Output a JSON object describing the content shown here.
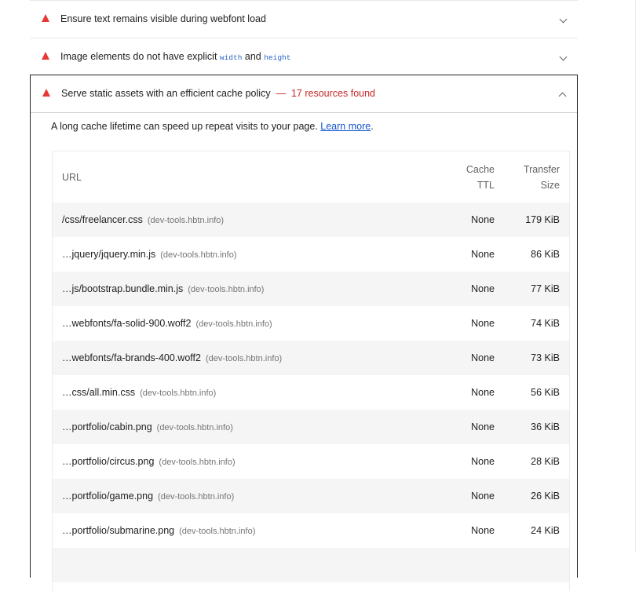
{
  "audits": [
    {
      "title": "Ensure text remains visible during webfont load",
      "status_icon": "fail-triangle-icon",
      "expanded": false
    },
    {
      "title_prefix": "Image elements do not have explicit ",
      "code_a": "width",
      "title_mid": " and ",
      "code_b": "height",
      "status_icon": "fail-triangle-icon",
      "expanded": false
    }
  ],
  "cache_audit": {
    "title": "Serve static assets with an efficient cache policy",
    "separator": "—",
    "display_value": "17 resources found",
    "description": "A long cache lifetime can speed up repeat visits to your page.",
    "learn_more": "Learn more",
    "description_end": ".",
    "status_icon": "fail-triangle-icon",
    "expanded": true
  },
  "table": {
    "headers": {
      "url": "URL",
      "ttl_line1": "Cache",
      "ttl_line2": "TTL",
      "size_line1": "Transfer",
      "size_line2": "Size"
    },
    "rows": [
      {
        "url": "/css/freelancer.css",
        "host": "(dev-tools.hbtn.info)",
        "ttl": "None",
        "size": "179 KiB"
      },
      {
        "url": "…jquery/jquery.min.js",
        "host": "(dev-tools.hbtn.info)",
        "ttl": "None",
        "size": "86 KiB"
      },
      {
        "url": "…js/bootstrap.bundle.min.js",
        "host": "(dev-tools.hbtn.info)",
        "ttl": "None",
        "size": "77 KiB"
      },
      {
        "url": "…webfonts/fa-solid-900.woff2",
        "host": "(dev-tools.hbtn.info)",
        "ttl": "None",
        "size": "74 KiB"
      },
      {
        "url": "…webfonts/fa-brands-400.woff2",
        "host": "(dev-tools.hbtn.info)",
        "ttl": "None",
        "size": "73 KiB"
      },
      {
        "url": "…css/all.min.css",
        "host": "(dev-tools.hbtn.info)",
        "ttl": "None",
        "size": "56 KiB"
      },
      {
        "url": "…portfolio/cabin.png",
        "host": "(dev-tools.hbtn.info)",
        "ttl": "None",
        "size": "36 KiB"
      },
      {
        "url": "…portfolio/circus.png",
        "host": "(dev-tools.hbtn.info)",
        "ttl": "None",
        "size": "28 KiB"
      },
      {
        "url": "…portfolio/game.png",
        "host": "(dev-tools.hbtn.info)",
        "ttl": "None",
        "size": "26 KiB"
      },
      {
        "url": "…portfolio/submarine.png",
        "host": "(dev-tools.hbtn.info)",
        "ttl": "None",
        "size": "24 KiB"
      }
    ]
  },
  "colors": {
    "fail": "#e53935",
    "link": "#1155cc",
    "display_value": "#c62828",
    "code": "#2962c4"
  }
}
